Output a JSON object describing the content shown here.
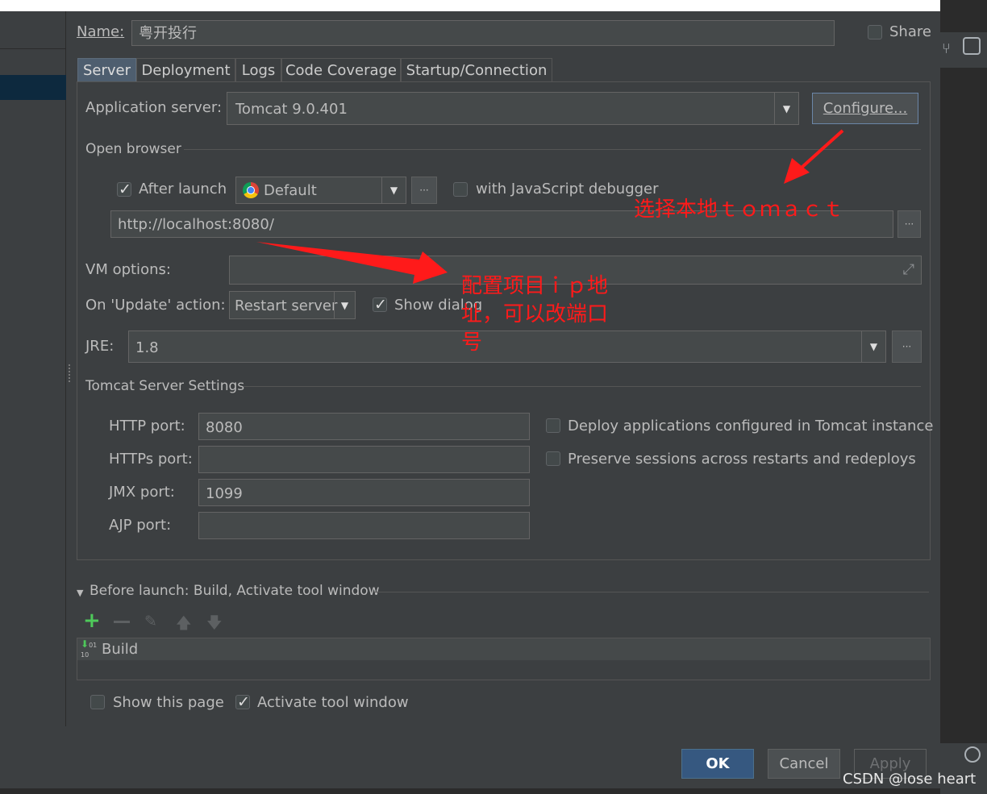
{
  "header": {
    "name_label": "Name:",
    "name_value": "粤开投行",
    "share_label": "Share"
  },
  "tabs": [
    {
      "label": "Server"
    },
    {
      "label": "Deployment"
    },
    {
      "label": "Logs"
    },
    {
      "label": "Code Coverage"
    },
    {
      "label": "Startup/Connection"
    }
  ],
  "server": {
    "app_server_label": "Application server:",
    "app_server_value": "Tomcat 9.0.401",
    "configure_label": "Configure...",
    "open_browser_label": "Open browser",
    "after_launch_label": "After launch",
    "browser_value": "Default",
    "js_debugger_label": "with JavaScript debugger",
    "url_value": "http://localhost:8080/",
    "vm_options_label": "VM options:",
    "vm_options_value": "",
    "update_action_label": "On 'Update' action:",
    "update_action_value": "Restart server",
    "show_dialog_label": "Show dialog",
    "jre_label": "JRE:",
    "jre_value": "1.8",
    "tomcat_settings_label": "Tomcat Server Settings",
    "http_port_label": "HTTP port:",
    "http_port_value": "8080",
    "https_port_label": "HTTPs port:",
    "https_port_value": "",
    "jmx_port_label": "JMX port:",
    "jmx_port_value": "1099",
    "ajp_port_label": "AJP port:",
    "ajp_port_value": "",
    "deploy_apps_label": "Deploy applications configured in Tomcat instance",
    "preserve_sessions_label": "Preserve sessions across restarts and redeploys",
    "ellipsis": "···"
  },
  "before_launch": {
    "title": "Before launch: Build, Activate tool window",
    "items": [
      {
        "label": "Build"
      }
    ],
    "show_page_label": "Show this page",
    "activate_tool_label": "Activate tool window"
  },
  "footer": {
    "ok_label": "OK",
    "cancel_label": "Cancel",
    "apply_label": "Apply"
  },
  "annotations": {
    "tomcat_note": "选择本地ｔｏｍａｃｔ",
    "ip_note_line1": "配置项目ｉｐ地",
    "ip_note_line2": "址，可以改端口",
    "ip_note_line3": "号"
  },
  "watermark": "CSDN @lose heart",
  "colors": {
    "accent_tab": "#4e5e6f",
    "annotation_red": "#ff1a1a",
    "add_green": "#4ec95a"
  }
}
